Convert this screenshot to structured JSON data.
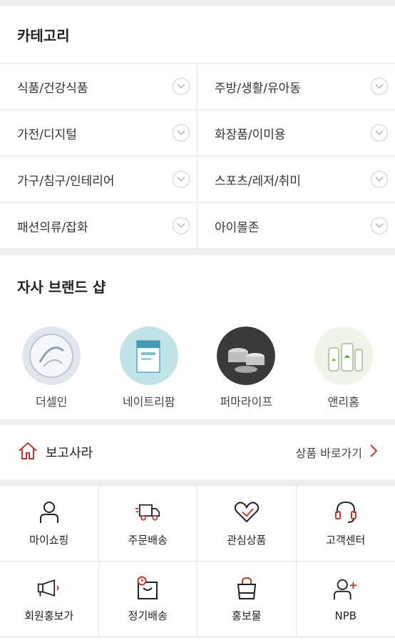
{
  "categories_section": {
    "title": "카테고리",
    "items": [
      {
        "label": "식품/건강식품"
      },
      {
        "label": "주방/생활/유아동"
      },
      {
        "label": "가전/디지털"
      },
      {
        "label": "화장품/이미용"
      },
      {
        "label": "가구/침구/인테리어"
      },
      {
        "label": "스포츠/레저/취미"
      },
      {
        "label": "패션의류/잡화"
      },
      {
        "label": "아이몰존"
      }
    ]
  },
  "brand_section": {
    "title": "자사 브랜드 샵",
    "brands": [
      {
        "label": "더셀인"
      },
      {
        "label": "네이트리팜"
      },
      {
        "label": "퍼마라이프"
      },
      {
        "label": "앤리홈"
      }
    ]
  },
  "bogo": {
    "label": "보고사라",
    "link_label": "상품 바로가기"
  },
  "menu": {
    "items": [
      {
        "label": "마이쇼핑",
        "icon": "person-icon"
      },
      {
        "label": "주문배송",
        "icon": "delivery-truck-icon"
      },
      {
        "label": "관심상품",
        "icon": "heart-icon"
      },
      {
        "label": "고객센터",
        "icon": "headset-icon"
      },
      {
        "label": "회원홍보가",
        "icon": "megaphone-icon"
      },
      {
        "label": "정기배송",
        "icon": "scheduled-bag-icon"
      },
      {
        "label": "홍보물",
        "icon": "shopping-bag-icon"
      },
      {
        "label": "NPB",
        "icon": "add-person-icon"
      }
    ]
  },
  "colors": {
    "accent": "#c0392b",
    "divider": "#e6e6e6",
    "gap": "#efefef"
  }
}
